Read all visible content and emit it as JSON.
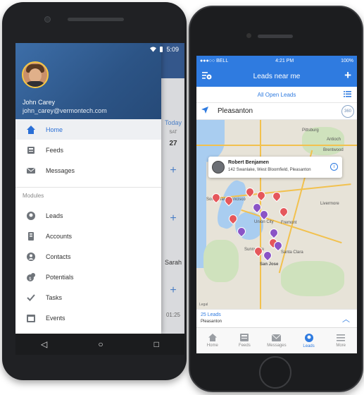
{
  "android": {
    "status": {
      "time": "5:09"
    },
    "drawer": {
      "user_name": "John Carey",
      "user_email": "john_carey@vermontech.com",
      "main_items": [
        {
          "label": "Home",
          "icon": "home-icon",
          "active": true
        },
        {
          "label": "Feeds",
          "icon": "feeds-icon",
          "active": false
        },
        {
          "label": "Messages",
          "icon": "messages-icon",
          "active": false
        }
      ],
      "modules_label": "Modules",
      "module_items": [
        {
          "label": "Leads",
          "icon": "leads-icon"
        },
        {
          "label": "Accounts",
          "icon": "accounts-icon"
        },
        {
          "label": "Contacts",
          "icon": "contacts-icon"
        },
        {
          "label": "Potentials",
          "icon": "potentials-icon"
        },
        {
          "label": "Tasks",
          "icon": "tasks-icon"
        },
        {
          "label": "Events",
          "icon": "events-icon"
        }
      ]
    },
    "behind": {
      "today": "Today",
      "sat": "SAT",
      "day": "27",
      "sarah": "Sarah",
      "time": "01:25"
    },
    "nav": {
      "back": "◁",
      "home": "○",
      "recents": "□"
    }
  },
  "iphone": {
    "status": {
      "carrier": "●●●○○ BELL",
      "time": "4:21 PM",
      "battery": "100%"
    },
    "title": "Leads near me",
    "filter_label": "All Open Leads",
    "search_value": "Pleasanton",
    "badge": "360",
    "callout": {
      "name": "Robert Benjamen",
      "address": "142 Swanlake, West Bloomfield, Pleasanton"
    },
    "map_cities": [
      "Pittsburg",
      "Antioch",
      "Brentwood",
      "Livermore",
      "South San Francisco",
      "Union City",
      "Fremont",
      "Sunnyvale",
      "Santa Clara",
      "San Jose"
    ],
    "legal": "Legal",
    "leads_count": "25 Leads",
    "leads_location": "Pleasanton",
    "tabs": [
      {
        "label": "Home",
        "icon": "home-icon",
        "active": false
      },
      {
        "label": "Feeds",
        "icon": "feeds-icon",
        "active": false
      },
      {
        "label": "Messages",
        "icon": "messages-icon",
        "active": false
      },
      {
        "label": "Leads",
        "icon": "leads-icon",
        "active": true
      },
      {
        "label": "More",
        "icon": "more-icon",
        "active": false
      }
    ]
  },
  "colors": {
    "accent": "#2f7be0",
    "drawer_header": "#2c5486",
    "pin_red": "#e5575b",
    "pin_purple": "#8a54c6"
  }
}
